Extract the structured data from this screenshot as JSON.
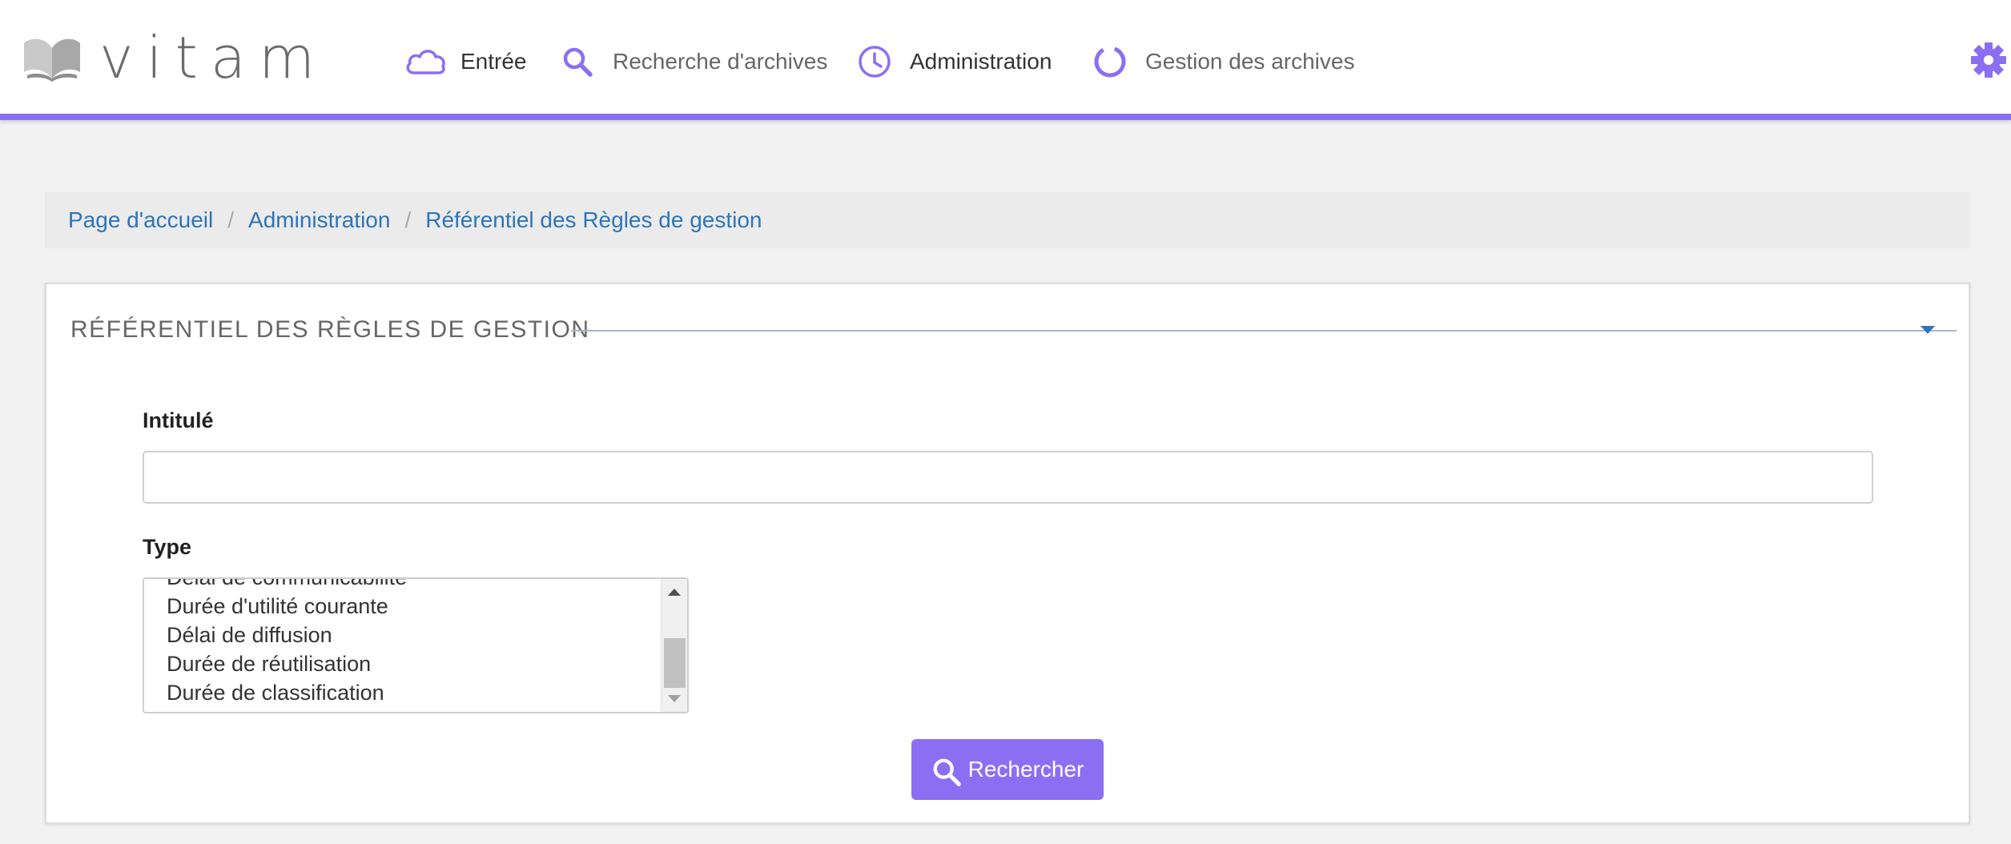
{
  "app": {
    "logo_text": "vitam",
    "accent": "#8b6ff3",
    "link_color": "#2e74b8"
  },
  "nav": {
    "items": [
      {
        "label": "Entrée",
        "icon": "cloud-icon"
      },
      {
        "label": "Recherche d'archives",
        "icon": "search-icon"
      },
      {
        "label": "Administration",
        "icon": "clock-icon"
      },
      {
        "label": "Gestion des archives",
        "icon": "circle-progress-icon"
      }
    ],
    "settings_icon": "gear-icon"
  },
  "breadcrumb": [
    "Page d'accueil",
    "Administration",
    "Référentiel des Règles de gestion"
  ],
  "panel": {
    "title": "RÉFÉRENTIEL DES RÈGLES DE GESTION",
    "fields": {
      "intitule_label": "Intitulé",
      "intitule_value": "",
      "type_label": "Type",
      "type_options": [
        "Délai de communicabilité",
        "Durée d'utilité courante",
        "Délai de diffusion",
        "Durée de réutilisation",
        "Durée de classification"
      ]
    },
    "search_button": "Rechercher"
  }
}
